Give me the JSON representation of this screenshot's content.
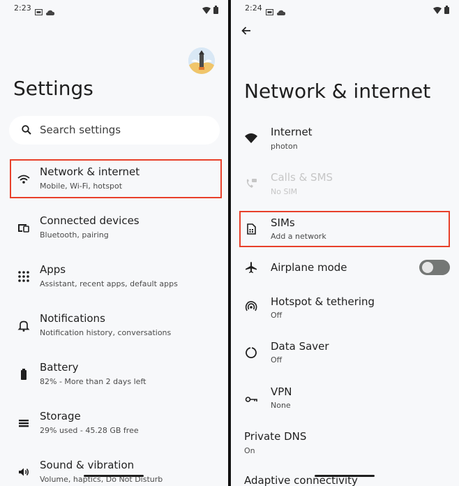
{
  "left": {
    "status": {
      "time": "2:23"
    },
    "title": "Settings",
    "search": {
      "placeholder": "Search settings"
    },
    "items": [
      {
        "title": "Network & internet",
        "subtitle": "Mobile, Wi-Fi, hotspot",
        "icon": "wifi-icon"
      },
      {
        "title": "Connected devices",
        "subtitle": "Bluetooth, pairing",
        "icon": "devices-icon"
      },
      {
        "title": "Apps",
        "subtitle": "Assistant, recent apps, default apps",
        "icon": "apps-grid-icon"
      },
      {
        "title": "Notifications",
        "subtitle": "Notification history, conversations",
        "icon": "bell-icon"
      },
      {
        "title": "Battery",
        "subtitle": "82% - More than 2 days left",
        "icon": "battery-icon"
      },
      {
        "title": "Storage",
        "subtitle": "29% used - 45.28 GB free",
        "icon": "storage-icon"
      },
      {
        "title": "Sound & vibration",
        "subtitle": "Volume, haptics, Do Not Disturb",
        "icon": "speaker-icon"
      }
    ]
  },
  "right": {
    "status": {
      "time": "2:24"
    },
    "title": "Network & internet",
    "items": [
      {
        "title": "Internet",
        "subtitle": "photon",
        "icon": "wifi-filled-icon"
      },
      {
        "title": "Calls & SMS",
        "subtitle": "No SIM",
        "icon": "calls-sms-icon"
      },
      {
        "title": "SIMs",
        "subtitle": "Add a network",
        "icon": "sim-card-icon"
      },
      {
        "title": "Airplane mode",
        "subtitle": "",
        "icon": "airplane-icon"
      },
      {
        "title": "Hotspot & tethering",
        "subtitle": "Off",
        "icon": "hotspot-icon"
      },
      {
        "title": "Data Saver",
        "subtitle": "Off",
        "icon": "data-saver-icon"
      },
      {
        "title": "VPN",
        "subtitle": "None",
        "icon": "vpn-key-icon"
      },
      {
        "title": "Private DNS",
        "subtitle": "On"
      },
      {
        "title": "Adaptive connectivity",
        "subtitle": ""
      }
    ],
    "airplane_toggle": {
      "on": false
    }
  },
  "colors": {
    "highlight": "#e8402a",
    "background": "#f7f8fa",
    "toggle_off": "#747775"
  }
}
